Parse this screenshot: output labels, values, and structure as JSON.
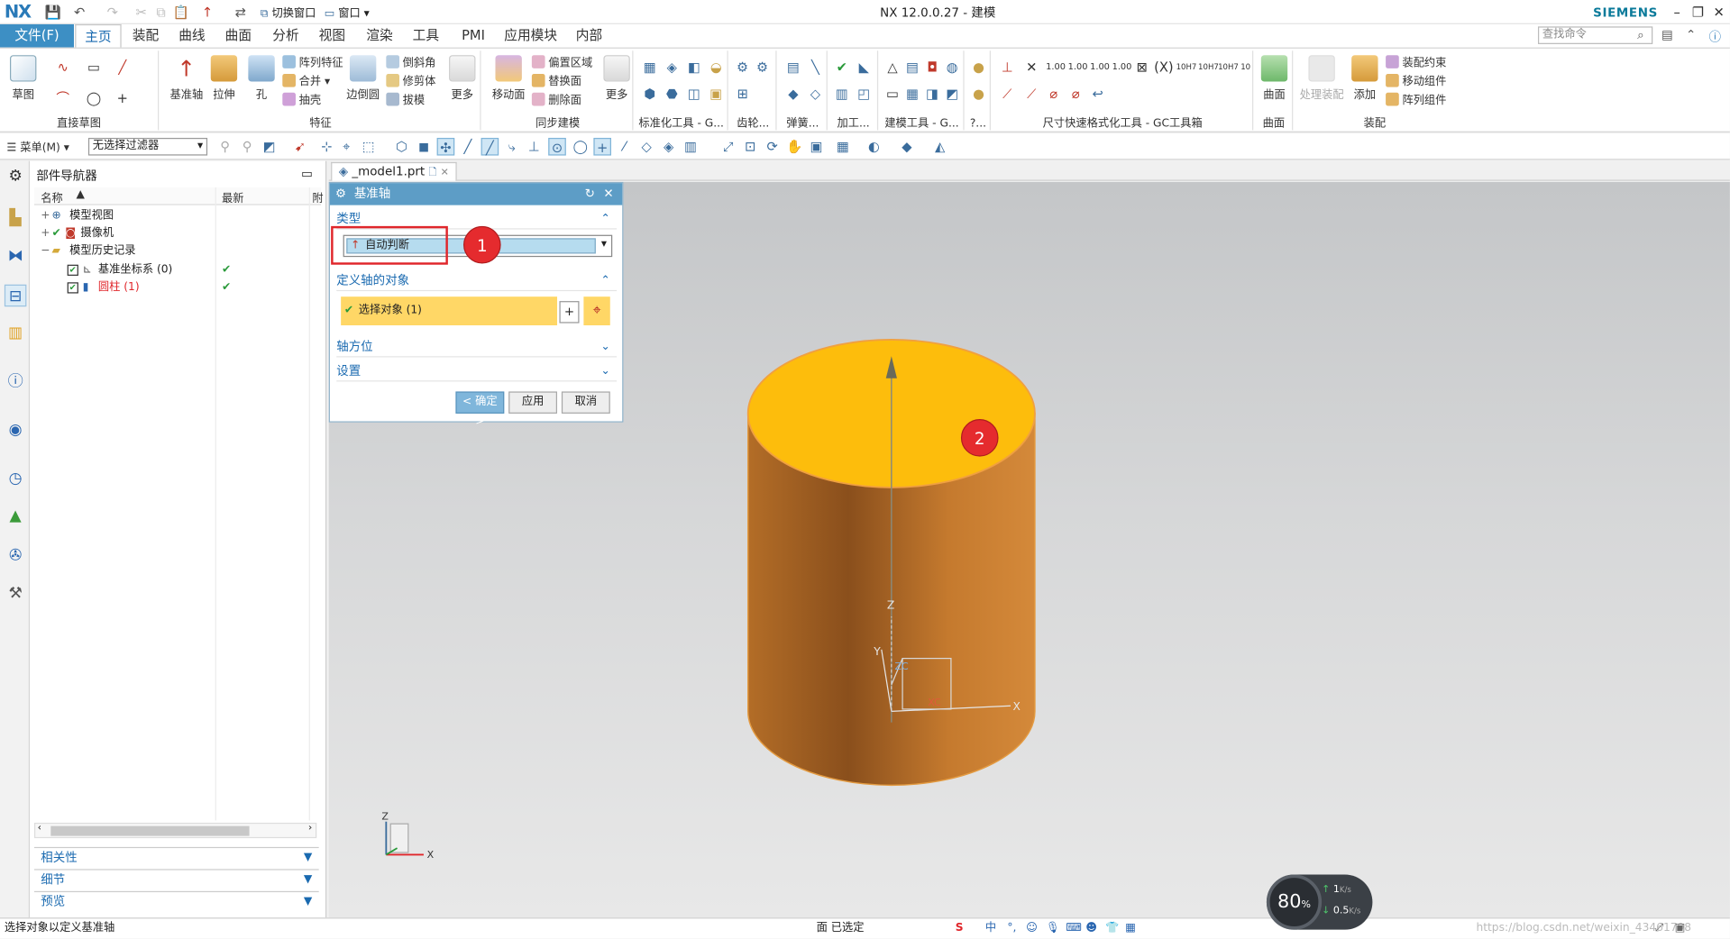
{
  "app": {
    "logo": "NX",
    "title": "NX 12.0.0.27 - 建模",
    "brand": "SIEMENS",
    "accent": "#3d8fc4"
  },
  "quick_access": {
    "switch_window": "切换窗口",
    "window": "窗口"
  },
  "tabs": [
    "文件(F)",
    "主页",
    "装配",
    "曲线",
    "曲面",
    "分析",
    "视图",
    "渲染",
    "工具",
    "PMI",
    "应用模块",
    "内部"
  ],
  "search_placeholder": "查找命令",
  "ribbon": {
    "direct_sketch": {
      "label": "直接草图",
      "sketch": "草图"
    },
    "datum_axis": "基准轴",
    "extrude": "拉伸",
    "hole": "孔",
    "feature": {
      "label": "特征",
      "pattern": "阵列特征",
      "unite": "合并",
      "shell": "抽壳",
      "edge_blend": "边倒圆",
      "chamfer": "倒斜角",
      "trim_body": "修剪体",
      "draft": "拔模",
      "more": "更多"
    },
    "sync": {
      "label": "同步建模",
      "move_face": "移动面",
      "offset_region": "偏置区域",
      "replace_face": "替换面",
      "delete_face": "删除面",
      "more": "更多"
    },
    "std_tools": "标准化工具 - G...",
    "gear": "齿轮...",
    "spring": "弹簧...",
    "process": "加工...",
    "model_tools": "建模工具 - G...",
    "more_q": "?...",
    "dim_tools": "尺寸快速格式化工具 - GC工具箱",
    "surface": {
      "label": "曲面",
      "btn": "曲面"
    },
    "assembly": {
      "label": "装配",
      "process_asm": "处理装配",
      "add": "添加",
      "asm_constraint": "装配约束",
      "move_comp": "移动组件",
      "pattern_comp": "阵列组件"
    }
  },
  "toolbar2": {
    "menu": "菜单(M)",
    "filter": "无选择过滤器"
  },
  "part_navigator": {
    "title": "部件导航器",
    "col_name": "名称",
    "col_latest": "最新",
    "col_extra": "附",
    "rows": [
      {
        "label": "模型视图",
        "latest": ""
      },
      {
        "label": "摄像机",
        "latest": ""
      },
      {
        "label": "模型历史记录",
        "latest": ""
      },
      {
        "label": "基准坐标系 (0)",
        "latest": "✔"
      },
      {
        "label": "圆柱 (1)",
        "latest": "✔"
      }
    ],
    "panels": [
      "相关性",
      "细节",
      "预览"
    ]
  },
  "doc_tab": "_model1.prt",
  "dialog": {
    "title": "基准轴",
    "type_section": "类型",
    "type_value": "自动判断",
    "define_section": "定义轴的对象",
    "select_object": "选择对象 (1)",
    "axis_orient": "轴方位",
    "settings": "设置",
    "ok": "< 确定 >",
    "apply": "应用",
    "cancel": "取消"
  },
  "markers": [
    "1",
    "2"
  ],
  "triad_labels": {
    "z": "Z",
    "x": "X",
    "y": "Y",
    "zc": "ZC",
    "xc": "XC"
  },
  "status": {
    "left": "选择对象以定义基准轴",
    "center": "面 已选定",
    "watermark": "https://blog.csdn.net/weixin_43461798"
  },
  "net_widget": {
    "percent": "80",
    "percent_unit": "%",
    "up": "1",
    "up_unit": "K/s",
    "down": "0.5",
    "down_unit": "K/s"
  }
}
